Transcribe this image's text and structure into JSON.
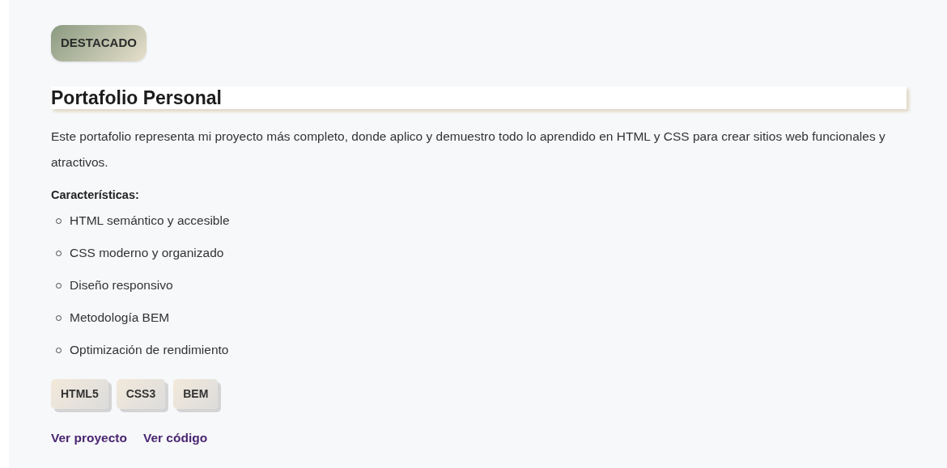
{
  "badge": "DESTACADO",
  "title": "Portafolio Personal",
  "description": "Este portafolio representa mi proyecto más completo, donde aplico y demuestro todo lo aprendido en HTML y CSS para crear sitios web funcionales y atractivos.",
  "features_heading": "Características:",
  "features": [
    "HTML semántico y accesible",
    "CSS moderno y organizado",
    "Diseño responsivo",
    "Metodología BEM",
    "Optimización de rendimiento"
  ],
  "tags": [
    "HTML5",
    "CSS3",
    "BEM"
  ],
  "links": [
    "Ver proyecto",
    "Ver código"
  ]
}
